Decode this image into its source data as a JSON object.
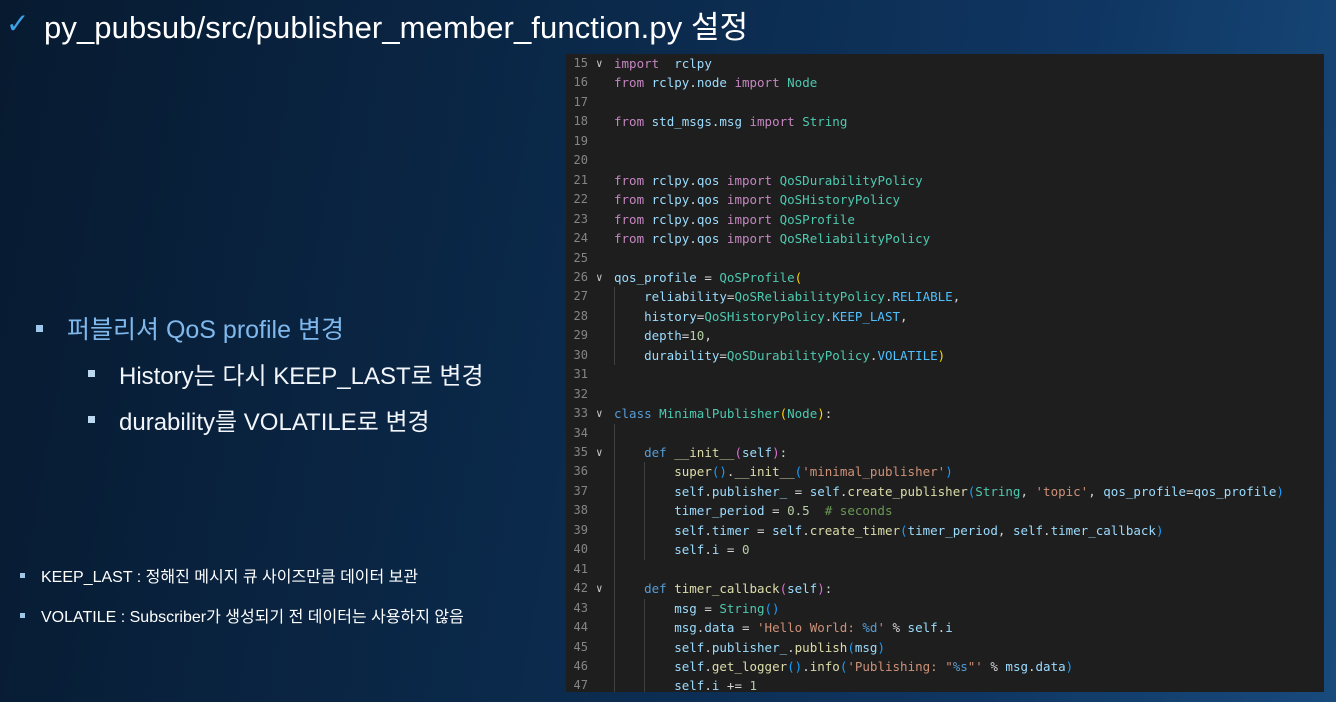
{
  "slide": {
    "title": "py_pubsub/src/publisher_member_function.py 설정",
    "title_icon": "check-mark-icon",
    "accent_color": "#3ea0e6",
    "bullets": {
      "main": "퍼블리셔 QoS profile 변경",
      "sub": [
        "History는 다시 KEEP_LAST로 변경",
        "durability를 VOLATILE로 변경"
      ]
    },
    "notes": [
      "KEEP_LAST : 정해진 메시지 큐 사이즈만큼 데이터 보관",
      "VOLATILE : Subscriber가 생성되기 전 데이터는 사용하지 않음"
    ]
  },
  "code_editor": {
    "background": "#1e1e1e",
    "lines": [
      {
        "n": "15",
        "fold": true,
        "tokens": [
          [
            "kw",
            "import"
          ],
          [
            "",
            "  "
          ],
          [
            "var",
            "rclpy"
          ]
        ]
      },
      {
        "n": "16",
        "fold": false,
        "tokens": [
          [
            "kw",
            "from"
          ],
          [
            "",
            " "
          ],
          [
            "var",
            "rclpy"
          ],
          [
            "",
            "."
          ],
          [
            "var",
            "node"
          ],
          [
            "",
            " "
          ],
          [
            "kw",
            "import"
          ],
          [
            "",
            " "
          ],
          [
            "cls",
            "Node"
          ]
        ]
      },
      {
        "n": "17",
        "fold": false,
        "tokens": []
      },
      {
        "n": "18",
        "fold": false,
        "tokens": [
          [
            "kw",
            "from"
          ],
          [
            "",
            " "
          ],
          [
            "var",
            "std_msgs"
          ],
          [
            "",
            "."
          ],
          [
            "var",
            "msg"
          ],
          [
            "",
            " "
          ],
          [
            "kw",
            "import"
          ],
          [
            "",
            " "
          ],
          [
            "cls",
            "String"
          ]
        ]
      },
      {
        "n": "19",
        "fold": false,
        "tokens": []
      },
      {
        "n": "20",
        "fold": false,
        "tokens": []
      },
      {
        "n": "21",
        "fold": false,
        "tokens": [
          [
            "kw",
            "from"
          ],
          [
            "",
            " "
          ],
          [
            "var",
            "rclpy"
          ],
          [
            "",
            "."
          ],
          [
            "var",
            "qos"
          ],
          [
            "",
            " "
          ],
          [
            "kw",
            "import"
          ],
          [
            "",
            " "
          ],
          [
            "cls",
            "QoSDurabilityPolicy"
          ]
        ]
      },
      {
        "n": "22",
        "fold": false,
        "tokens": [
          [
            "kw",
            "from"
          ],
          [
            "",
            " "
          ],
          [
            "var",
            "rclpy"
          ],
          [
            "",
            "."
          ],
          [
            "var",
            "qos"
          ],
          [
            "",
            " "
          ],
          [
            "kw",
            "import"
          ],
          [
            "",
            " "
          ],
          [
            "cls",
            "QoSHistoryPolicy"
          ]
        ]
      },
      {
        "n": "23",
        "fold": false,
        "tokens": [
          [
            "kw",
            "from"
          ],
          [
            "",
            " "
          ],
          [
            "var",
            "rclpy"
          ],
          [
            "",
            "."
          ],
          [
            "var",
            "qos"
          ],
          [
            "",
            " "
          ],
          [
            "kw",
            "import"
          ],
          [
            "",
            " "
          ],
          [
            "cls",
            "QoSProfile"
          ]
        ]
      },
      {
        "n": "24",
        "fold": false,
        "tokens": [
          [
            "kw",
            "from"
          ],
          [
            "",
            " "
          ],
          [
            "var",
            "rclpy"
          ],
          [
            "",
            "."
          ],
          [
            "var",
            "qos"
          ],
          [
            "",
            " "
          ],
          [
            "kw",
            "import"
          ],
          [
            "",
            " "
          ],
          [
            "cls",
            "QoSReliabilityPolicy"
          ]
        ]
      },
      {
        "n": "25",
        "fold": false,
        "tokens": []
      },
      {
        "n": "26",
        "fold": true,
        "tokens": [
          [
            "var",
            "qos_profile"
          ],
          [
            "",
            " = "
          ],
          [
            "cls",
            "QoSProfile"
          ],
          [
            "par",
            "("
          ]
        ]
      },
      {
        "n": "27",
        "fold": false,
        "tokens": [
          [
            "",
            "    "
          ],
          [
            "var",
            "reliability"
          ],
          [
            "",
            "="
          ],
          [
            "cls",
            "QoSReliabilityPolicy"
          ],
          [
            "",
            "."
          ],
          [
            "const",
            "RELIABLE"
          ],
          [
            "",
            ","
          ]
        ]
      },
      {
        "n": "28",
        "fold": false,
        "tokens": [
          [
            "",
            "    "
          ],
          [
            "var",
            "history"
          ],
          [
            "",
            "="
          ],
          [
            "cls",
            "QoSHistoryPolicy"
          ],
          [
            "",
            "."
          ],
          [
            "const",
            "KEEP_LAST"
          ],
          [
            "",
            ","
          ]
        ]
      },
      {
        "n": "29",
        "fold": false,
        "tokens": [
          [
            "",
            "    "
          ],
          [
            "var",
            "depth"
          ],
          [
            "",
            "="
          ],
          [
            "num",
            "10"
          ],
          [
            "",
            ","
          ]
        ]
      },
      {
        "n": "30",
        "fold": false,
        "tokens": [
          [
            "",
            "    "
          ],
          [
            "var",
            "durability"
          ],
          [
            "",
            "="
          ],
          [
            "cls",
            "QoSDurabilityPolicy"
          ],
          [
            "",
            "."
          ],
          [
            "const",
            "VOLATILE"
          ],
          [
            "par",
            ")"
          ]
        ]
      },
      {
        "n": "31",
        "fold": false,
        "tokens": []
      },
      {
        "n": "32",
        "fold": false,
        "tokens": []
      },
      {
        "n": "33",
        "fold": true,
        "tokens": [
          [
            "kwb",
            "class"
          ],
          [
            "",
            " "
          ],
          [
            "cls",
            "MinimalPublisher"
          ],
          [
            "par",
            "("
          ],
          [
            "cls",
            "Node"
          ],
          [
            "par",
            ")"
          ],
          [
            "",
            ":"
          ]
        ]
      },
      {
        "n": "34",
        "fold": false,
        "tokens": []
      },
      {
        "n": "35",
        "fold": true,
        "tokens": [
          [
            "",
            "    "
          ],
          [
            "kwb",
            "def"
          ],
          [
            "",
            " "
          ],
          [
            "fn",
            "__init__"
          ],
          [
            "par2",
            "("
          ],
          [
            "var",
            "self"
          ],
          [
            "par2",
            ")"
          ],
          [
            "",
            ":"
          ]
        ]
      },
      {
        "n": "36",
        "fold": false,
        "tokens": [
          [
            "",
            "        "
          ],
          [
            "fn",
            "super"
          ],
          [
            "par3",
            "()"
          ],
          [
            "",
            "."
          ],
          [
            "fn",
            "__init__"
          ],
          [
            "par3",
            "("
          ],
          [
            "str",
            "'minimal_publisher'"
          ],
          [
            "par3",
            ")"
          ]
        ]
      },
      {
        "n": "37",
        "fold": false,
        "tokens": [
          [
            "",
            "        "
          ],
          [
            "var",
            "self"
          ],
          [
            "",
            "."
          ],
          [
            "var",
            "publisher_"
          ],
          [
            "",
            " = "
          ],
          [
            "var",
            "self"
          ],
          [
            "",
            "."
          ],
          [
            "fn",
            "create_publisher"
          ],
          [
            "par3",
            "("
          ],
          [
            "cls",
            "String"
          ],
          [
            "",
            ", "
          ],
          [
            "str",
            "'topic'"
          ],
          [
            "",
            ", "
          ],
          [
            "var",
            "qos_profile"
          ],
          [
            "",
            "="
          ],
          [
            "var",
            "qos_profile"
          ],
          [
            "par3",
            ")"
          ]
        ]
      },
      {
        "n": "38",
        "fold": false,
        "tokens": [
          [
            "",
            "        "
          ],
          [
            "var",
            "timer_period"
          ],
          [
            "",
            " = "
          ],
          [
            "num",
            "0.5"
          ],
          [
            "",
            "  "
          ],
          [
            "cmt",
            "# seconds"
          ]
        ]
      },
      {
        "n": "39",
        "fold": false,
        "tokens": [
          [
            "",
            "        "
          ],
          [
            "var",
            "self"
          ],
          [
            "",
            "."
          ],
          [
            "var",
            "timer"
          ],
          [
            "",
            " = "
          ],
          [
            "var",
            "self"
          ],
          [
            "",
            "."
          ],
          [
            "fn",
            "create_timer"
          ],
          [
            "par3",
            "("
          ],
          [
            "var",
            "timer_period"
          ],
          [
            "",
            ", "
          ],
          [
            "var",
            "self"
          ],
          [
            "",
            "."
          ],
          [
            "var",
            "timer_callback"
          ],
          [
            "par3",
            ")"
          ]
        ]
      },
      {
        "n": "40",
        "fold": false,
        "tokens": [
          [
            "",
            "        "
          ],
          [
            "var",
            "self"
          ],
          [
            "",
            "."
          ],
          [
            "var",
            "i"
          ],
          [
            "",
            " = "
          ],
          [
            "num",
            "0"
          ]
        ]
      },
      {
        "n": "41",
        "fold": false,
        "tokens": []
      },
      {
        "n": "42",
        "fold": true,
        "tokens": [
          [
            "",
            "    "
          ],
          [
            "kwb",
            "def"
          ],
          [
            "",
            " "
          ],
          [
            "fn",
            "timer_callback"
          ],
          [
            "par2",
            "("
          ],
          [
            "var",
            "self"
          ],
          [
            "par2",
            ")"
          ],
          [
            "",
            ":"
          ]
        ]
      },
      {
        "n": "43",
        "fold": false,
        "tokens": [
          [
            "",
            "        "
          ],
          [
            "var",
            "msg"
          ],
          [
            "",
            " = "
          ],
          [
            "cls",
            "String"
          ],
          [
            "par3",
            "()"
          ]
        ]
      },
      {
        "n": "44",
        "fold": false,
        "tokens": [
          [
            "",
            "        "
          ],
          [
            "var",
            "msg"
          ],
          [
            "",
            "."
          ],
          [
            "var",
            "data"
          ],
          [
            "",
            " = "
          ],
          [
            "str",
            "'Hello World: "
          ],
          [
            "kwb",
            "%d"
          ],
          [
            "str",
            "'"
          ],
          [
            "",
            " % "
          ],
          [
            "var",
            "self"
          ],
          [
            "",
            "."
          ],
          [
            "var",
            "i"
          ]
        ]
      },
      {
        "n": "45",
        "fold": false,
        "tokens": [
          [
            "",
            "        "
          ],
          [
            "var",
            "self"
          ],
          [
            "",
            "."
          ],
          [
            "var",
            "publisher_"
          ],
          [
            "",
            "."
          ],
          [
            "fn",
            "publish"
          ],
          [
            "par3",
            "("
          ],
          [
            "var",
            "msg"
          ],
          [
            "par3",
            ")"
          ]
        ]
      },
      {
        "n": "46",
        "fold": false,
        "tokens": [
          [
            "",
            "        "
          ],
          [
            "var",
            "self"
          ],
          [
            "",
            "."
          ],
          [
            "fn",
            "get_logger"
          ],
          [
            "par3",
            "()"
          ],
          [
            "",
            "."
          ],
          [
            "fn",
            "info"
          ],
          [
            "par3",
            "("
          ],
          [
            "str",
            "'Publishing: \""
          ],
          [
            "kwb",
            "%s"
          ],
          [
            "str",
            "\"'"
          ],
          [
            "",
            " % "
          ],
          [
            "var",
            "msg"
          ],
          [
            "",
            "."
          ],
          [
            "var",
            "data"
          ],
          [
            "par3",
            ")"
          ]
        ]
      },
      {
        "n": "47",
        "fold": false,
        "tokens": [
          [
            "",
            "        "
          ],
          [
            "var",
            "self"
          ],
          [
            "",
            "."
          ],
          [
            "var",
            "i"
          ],
          [
            "",
            " += "
          ],
          [
            "num",
            "1"
          ]
        ]
      }
    ]
  }
}
